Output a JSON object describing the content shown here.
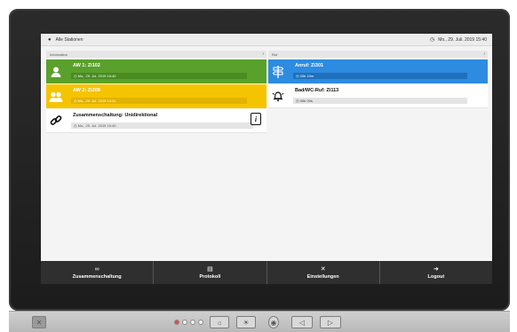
{
  "topbar": {
    "location": "Alle Stationen",
    "datetime": "Mo., 29. Juli. 2019 15:40"
  },
  "columns": {
    "left_title": "Information",
    "right_title": "Ruf"
  },
  "cards_left": [
    {
      "title": "AW 1: Zi102",
      "sub": "Mo., 29. Jul. 2019 15:40",
      "color": "#5aa02c"
    },
    {
      "title": "AW 2: Zi209",
      "sub": "Mo., 29. Jul. 2019 15:41",
      "color": "#f5c400"
    },
    {
      "title": "Zusammenschaltung: Unidirektional",
      "sub": "Mo., 29. Jul. 2019 15:40",
      "color": "#ffffff"
    }
  ],
  "cards_right": [
    {
      "title": "Anruf: Zi301",
      "sub": "00h 10m",
      "color": "#2d8be0"
    },
    {
      "title": "Bad/WC-Ruf: Zi113",
      "sub": "00h 00s",
      "color": "#ffffff"
    }
  ],
  "nav": [
    {
      "label": "Zusammenschaltung",
      "icon": "link-icon"
    },
    {
      "label": "Protokoll",
      "icon": "document-icon"
    },
    {
      "label": "Einstellungen",
      "icon": "tools-icon"
    },
    {
      "label": "Logout",
      "icon": "logout-icon"
    }
  ],
  "info_badge": "i"
}
